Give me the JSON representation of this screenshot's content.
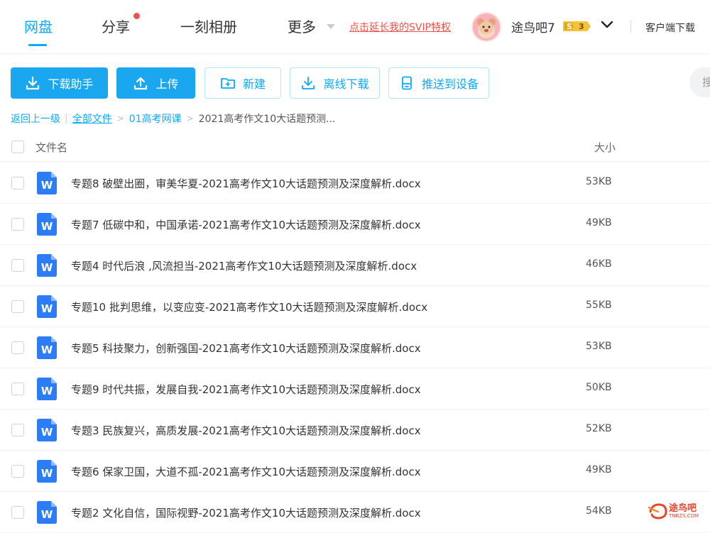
{
  "nav": {
    "items": [
      {
        "label": "网盘",
        "active": true
      },
      {
        "label": "分享",
        "active": false,
        "has_badge": true
      },
      {
        "label": "一刻相册",
        "active": false
      },
      {
        "label": "更多",
        "active": false
      }
    ],
    "promo_link": "点击延长我的SVIP特权",
    "username": "途鸟吧7",
    "vip_level": "3",
    "client_download": "客户端下载"
  },
  "toolbar": {
    "download_helper": "下载助手",
    "upload": "上传",
    "new_folder": "新建",
    "offline_download": "离线下载",
    "push_to_device": "推送到设备",
    "search_placeholder": "搜"
  },
  "breadcrumb": {
    "back": "返回上一级",
    "all_files": "全部文件",
    "folder": "01高考网课",
    "current": "2021高考作文10大话题预测..."
  },
  "table": {
    "col_name": "文件名",
    "col_size": "大小",
    "rows": [
      {
        "name": "专题8 破壁出圈，审美华夏-2021高考作文10大话题预测及深度解析.docx",
        "size": "53KB"
      },
      {
        "name": "专题7 低碳中和，中国承诺-2021高考作文10大话题预测及深度解析.docx",
        "size": "49KB"
      },
      {
        "name": "专题4 时代后浪 ,风流担当-2021高考作文10大话题预测及深度解析.docx",
        "size": "46KB"
      },
      {
        "name": "专题10 批判思维，以变应变-2021高考作文10大话题预测及深度解析.docx",
        "size": "55KB"
      },
      {
        "name": "专题5 科技聚力，创新强国-2021高考作文10大话题预测及深度解析.docx",
        "size": "53KB"
      },
      {
        "name": "专题9 时代共振，发展自我-2021高考作文10大话题预测及深度解析.docx",
        "size": "50KB"
      },
      {
        "name": "专题3 民族复兴，高质发展-2021高考作文10大话题预测及深度解析.docx",
        "size": "52KB"
      },
      {
        "name": "专题6 保家卫国，大道不孤-2021高考作文10大话题预测及深度解析.docx",
        "size": "49KB"
      },
      {
        "name": "专题2 文化自信，国际视野-2021高考作文10大话题预测及深度解析.docx",
        "size": "54KB"
      }
    ]
  },
  "watermark": {
    "title": "途鸟吧",
    "sub": "TNBZS.COM"
  },
  "icons": {
    "file_type": "word-doc-icon",
    "download": "download-icon",
    "upload": "upload-icon",
    "new_folder": "folder-plus-icon",
    "offline": "offline-download-icon",
    "device": "device-icon",
    "chevron": "chevron-down-icon"
  },
  "colors": {
    "accent": "#09aaff",
    "primary_button": "#1aa7f0",
    "promo": "#f0534a",
    "word_icon": "#2b7cf5"
  }
}
